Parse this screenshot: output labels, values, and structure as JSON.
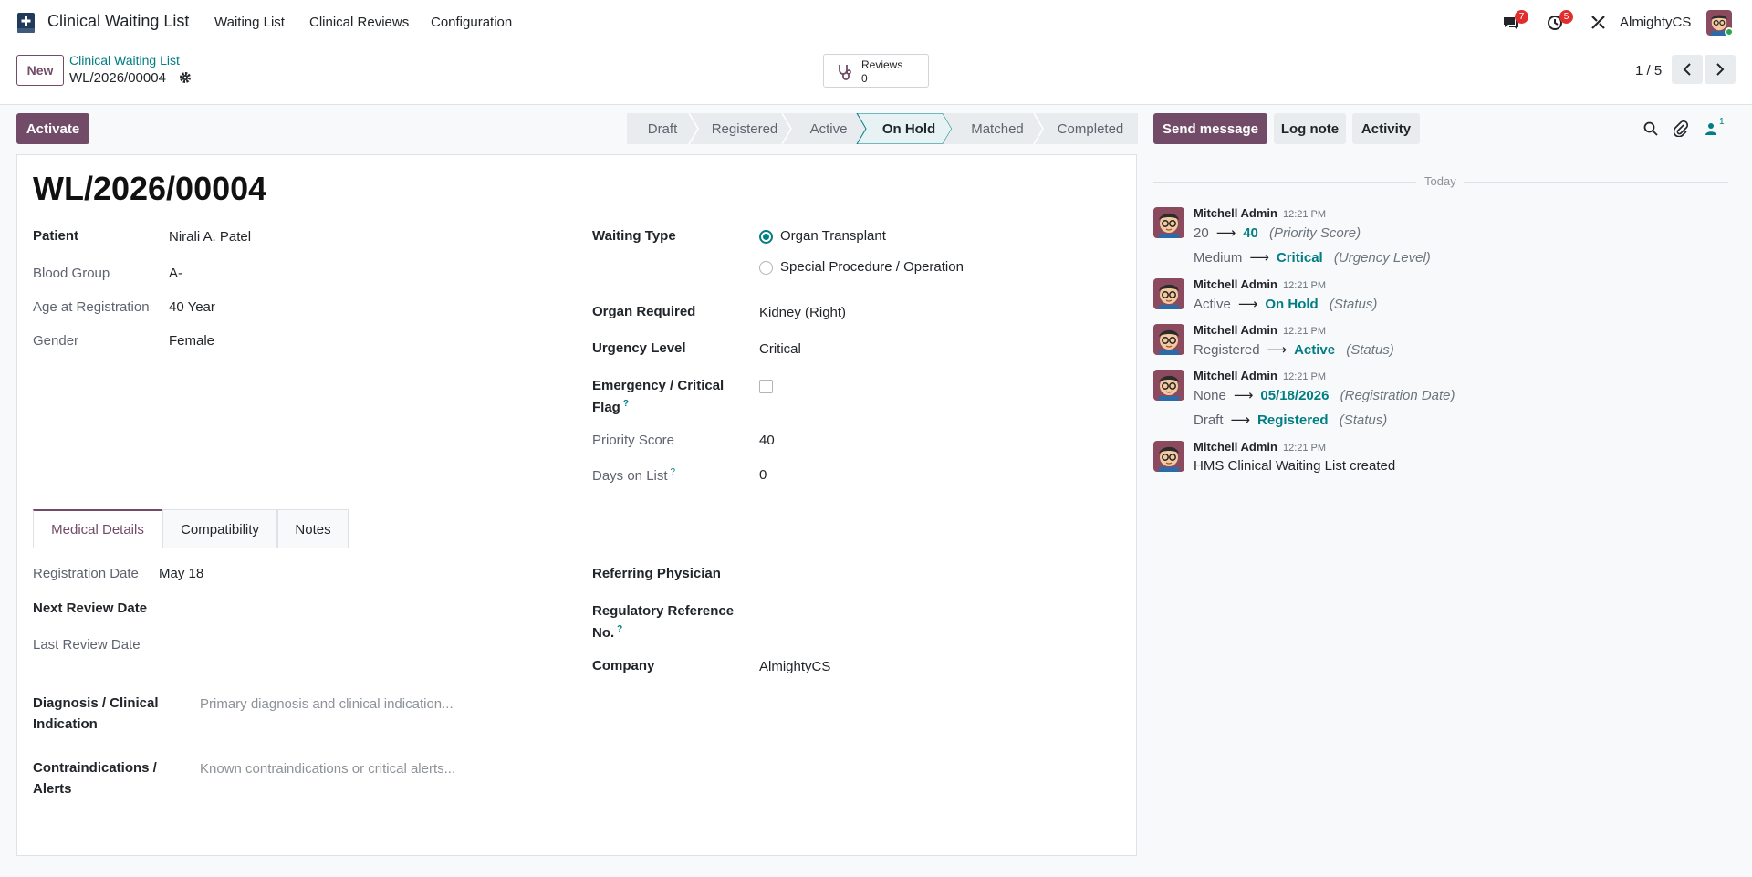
{
  "navbar": {
    "app_name": "Clinical Waiting List",
    "menu": [
      "Waiting List",
      "Clinical Reviews",
      "Configuration"
    ],
    "messages_badge": "7",
    "activities_badge": "5",
    "company": "AlmightyCS"
  },
  "control_panel": {
    "new_label": "New",
    "breadcrumb_parent": "Clinical Waiting List",
    "breadcrumb_current": "WL/2026/00004",
    "smart_button": {
      "label": "Reviews",
      "value": "0"
    },
    "pager": "1 / 5"
  },
  "actions": {
    "activate": "Activate"
  },
  "statusbar": [
    "Draft",
    "Registered",
    "Active",
    "On Hold",
    "Matched",
    "Completed"
  ],
  "statusbar_active": "On Hold",
  "record": {
    "title": "WL/2026/00004",
    "patient_label": "Patient",
    "patient": "Nirali A. Patel",
    "blood_group_label": "Blood Group",
    "blood_group": "A-",
    "age_label": "Age at Registration",
    "age": "40 Year",
    "gender_label": "Gender",
    "gender": "Female",
    "waiting_type_label": "Waiting Type",
    "waiting_type_options": [
      "Organ Transplant",
      "Special Procedure / Operation"
    ],
    "waiting_type_selected": "Organ Transplant",
    "organ_label": "Organ Required",
    "organ": "Kidney (Right)",
    "urgency_label": "Urgency Level",
    "urgency": "Critical",
    "emergency_label_1": "Emergency / Critical",
    "emergency_label_2": "Flag",
    "emergency_flag": false,
    "priority_label": "Priority Score",
    "priority": "40",
    "days_label": "Days on List",
    "days": "0"
  },
  "tabs": [
    "Medical Details",
    "Compatibility",
    "Notes"
  ],
  "medical": {
    "reg_date_label": "Registration Date",
    "reg_date": "May 18",
    "next_review_label": "Next Review Date",
    "last_review_label": "Last Review Date",
    "referring_label": "Referring Physician",
    "regulatory_label_1": "Regulatory Reference",
    "regulatory_label_2": "No.",
    "company_label": "Company",
    "company": "AlmightyCS",
    "diagnosis_label_1": "Diagnosis / Clinical",
    "diagnosis_label_2": "Indication",
    "diagnosis_placeholder": "Primary diagnosis and clinical indication...",
    "contra_label_1": "Contraindications /",
    "contra_label_2": "Alerts",
    "contra_placeholder": "Known contraindications or critical alerts..."
  },
  "chatter": {
    "send_message": "Send message",
    "log_note": "Log note",
    "activity": "Activity",
    "followers_count": "1",
    "date_separator": "Today",
    "messages": [
      {
        "author": "Mitchell Admin",
        "time": "12:21 PM",
        "tracking": [
          {
            "old": "20",
            "new": "40",
            "field": "(Priority Score)"
          },
          {
            "old": "Medium",
            "new": "Critical",
            "field": "(Urgency Level)"
          }
        ]
      },
      {
        "author": "Mitchell Admin",
        "time": "12:21 PM",
        "tracking": [
          {
            "old": "Active",
            "new": "On Hold",
            "field": "(Status)"
          }
        ]
      },
      {
        "author": "Mitchell Admin",
        "time": "12:21 PM",
        "tracking": [
          {
            "old": "Registered",
            "new": "Active",
            "field": "(Status)"
          }
        ]
      },
      {
        "author": "Mitchell Admin",
        "time": "12:21 PM",
        "tracking": [
          {
            "old": "None",
            "new": "05/18/2026",
            "field": "(Registration Date)"
          },
          {
            "old": "Draft",
            "new": "Registered",
            "field": "(Status)"
          }
        ]
      },
      {
        "author": "Mitchell Admin",
        "time": "12:21 PM",
        "body": "HMS Clinical Waiting List created"
      }
    ]
  },
  "icons": {
    "app": "medical-book-icon",
    "messages": "chat-bubbles-icon",
    "activities": "clock-icon",
    "debug": "tools-icon",
    "reviews": "stethoscope-icon",
    "search": "search-icon",
    "attach": "paperclip-icon",
    "followers": "person-icon"
  },
  "colors": {
    "brand": "#714b67",
    "accent": "#017e84",
    "badge": "#e02d2d"
  }
}
